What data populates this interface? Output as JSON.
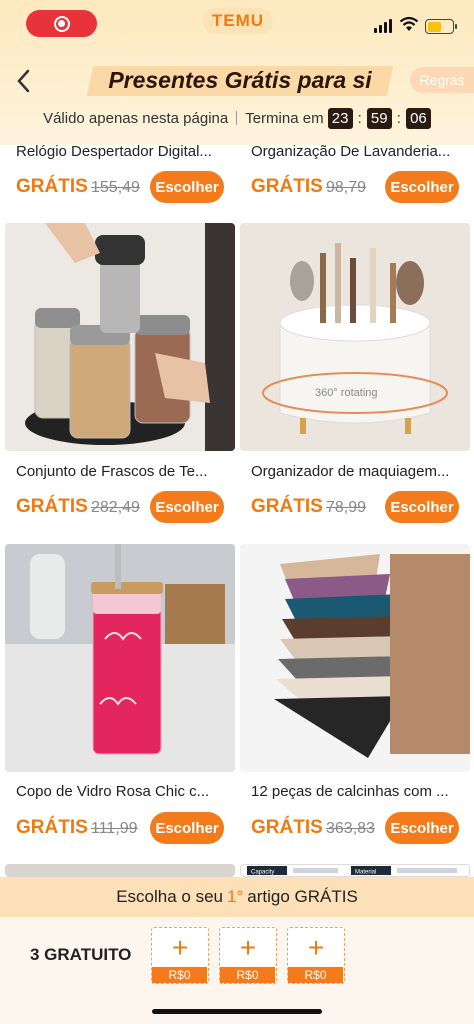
{
  "status": {
    "brand": "TEMU"
  },
  "header": {
    "title": "Presentes Grátis para si",
    "rules_label": "Regras",
    "valid_text": "Válido apenas nesta página",
    "ends_label": "Termina em",
    "timer": {
      "h": "23",
      "m": "59",
      "s": "06"
    }
  },
  "products": [
    {
      "name": "Relógio Despertador Digital...",
      "free": "GRÁTIS",
      "old_price": "155,49",
      "button": "Escolher"
    },
    {
      "name": "Organização De Lavanderia...",
      "free": "GRÁTIS",
      "old_price": "98,79",
      "button": "Escolher"
    },
    {
      "name": "Conjunto de Frascos de Te...",
      "free": "GRÁTIS",
      "old_price": "282,49",
      "button": "Escolher"
    },
    {
      "name": "Organizador de maquiagem...",
      "free": "GRÁTIS",
      "old_price": "78,99",
      "button": "Escolher"
    },
    {
      "name": "Copo de Vidro Rosa Chic c...",
      "free": "GRÁTIS",
      "old_price": "111,99",
      "button": "Escolher"
    },
    {
      "name": "12 peças de calcinhas com ...",
      "free": "GRÁTIS",
      "old_price": "363,83",
      "button": "Escolher"
    }
  ],
  "image_labels": {
    "rotating": "360° rotating",
    "capacity": "Capacity",
    "material": "Material"
  },
  "bottom": {
    "choose_pre": "Escolha o seu",
    "choose_num": "1°",
    "choose_post": "artigo GRÁTIS",
    "free_count": "3 GRATUITO",
    "slots": [
      {
        "plus": "+",
        "price": "R$0"
      },
      {
        "plus": "+",
        "price": "R$0"
      },
      {
        "plus": "+",
        "price": "R$0"
      }
    ]
  },
  "colors": {
    "accent": "#f47b1b",
    "header_bg": "#fde9bf",
    "free_text": "#f07a12"
  },
  "icons": [
    "record-icon",
    "signal-icon",
    "wifi-icon",
    "battery-icon",
    "back-arrow-icon",
    "plus-icon"
  ]
}
